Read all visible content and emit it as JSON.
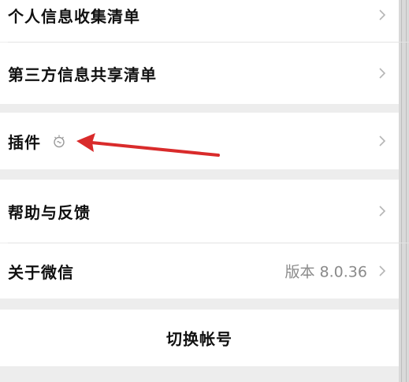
{
  "settings": {
    "items": [
      {
        "label": "个人信息收集清单"
      },
      {
        "label": "第三方信息共享清单"
      },
      {
        "label": "插件",
        "icon": "plugin-bulb-icon"
      },
      {
        "label": "帮助与反馈"
      },
      {
        "label": "关于微信",
        "value": "版本 8.0.36"
      }
    ],
    "switch_account": "切换帐号"
  },
  "annotation": {
    "color": "#d92b2b"
  }
}
